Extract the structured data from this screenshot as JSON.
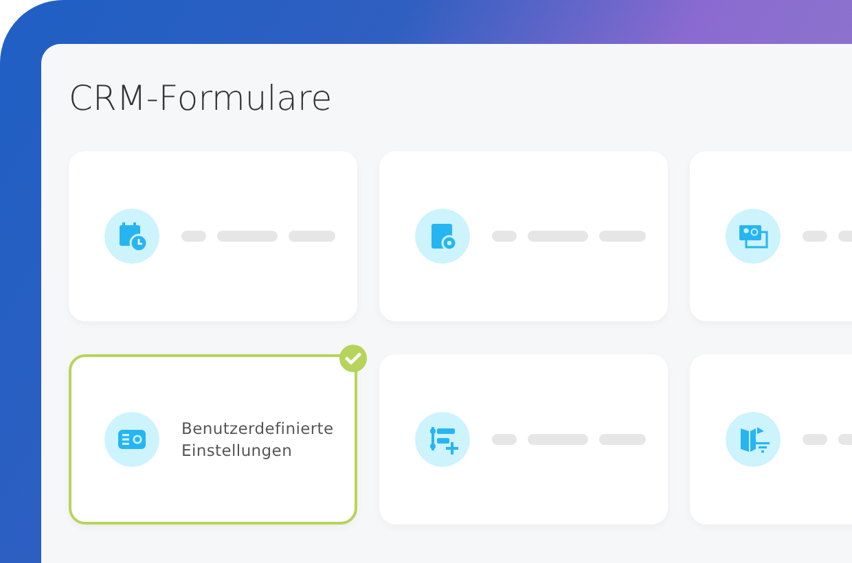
{
  "title": "CRM-Formulare",
  "cards": [
    {
      "kind": "skeleton",
      "selected": false
    },
    {
      "kind": "skeleton",
      "selected": false
    },
    {
      "kind": "skeleton",
      "selected": false
    },
    {
      "kind": "text",
      "selected": true,
      "label": "Benutzerdefinierte Einstellungen"
    },
    {
      "kind": "skeleton",
      "selected": false
    },
    {
      "kind": "skeleton",
      "selected": false
    }
  ]
}
